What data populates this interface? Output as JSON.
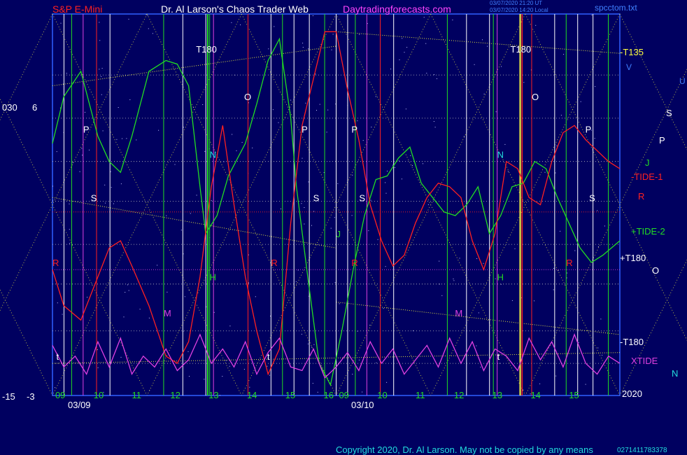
{
  "header": {
    "symbol": "S&P E-Mini",
    "author": "Dr. Al Larson's Chaos Trader Web",
    "site": "Daytradingforecasts.com",
    "timestamp1": "03/07/2020 21:20 UT",
    "timestamp2": "03/07/2020 14:20 Local",
    "file": "spcctom.txt"
  },
  "left_axis": {
    "top_a": "030",
    "top_b": "6",
    "bottom_a": "-15",
    "bottom_b": "-3"
  },
  "dates": [
    "03/09",
    "03/10"
  ],
  "right_labels": {
    "t135": "-T135",
    "v": "V",
    "u": "U",
    "s": "S",
    "p": "P",
    "j": "J",
    "tide1": "-TIDE-1",
    "r": "R",
    "tide2": "+TIDE-2",
    "t180a": "+T180",
    "o": "O",
    "t180b": "-T180",
    "xtide": "XTIDE",
    "n": "N",
    "year": "2020"
  },
  "footer": {
    "copyright": "Copyright 2020, Dr. Al Larson. May not be copied by any means",
    "code": "0271411783378"
  },
  "colors": {
    "background": "#000060",
    "plot_border": "#3060ff",
    "green": "#22dd22",
    "red": "#ff2020",
    "magenta": "#e040e0",
    "yellow_dotted": "#e0e040"
  },
  "chart_data": {
    "type": "line",
    "title": "S&P E-Mini",
    "x_ticks_day1": [
      "09",
      "10",
      "11",
      "12",
      "13",
      "14",
      "15",
      "16"
    ],
    "x_ticks_day2": [
      "09",
      "10",
      "11",
      "12",
      "13",
      "14",
      "15"
    ],
    "markers_top": [
      {
        "label": "T180",
        "x": 12.8,
        "day": 1
      },
      {
        "label": "T180",
        "x": 13.6,
        "day": 2
      }
    ],
    "planet_letters": [
      {
        "l": "P",
        "x": 9.6,
        "y": 0.7,
        "c": "#ffffff"
      },
      {
        "l": "S",
        "x": 9.8,
        "y": 0.51,
        "c": "#ffffff"
      },
      {
        "l": "R",
        "x": 8.8,
        "y": 0.33,
        "c": "#ff2020"
      },
      {
        "l": "M",
        "x": 11.7,
        "y": 0.19,
        "c": "#e040e0"
      },
      {
        "l": "t",
        "x": 8.9,
        "y": 0.07,
        "c": "#ffffff"
      },
      {
        "l": "N",
        "x": 12.9,
        "y": 0.63,
        "c": "#22dddd"
      },
      {
        "l": "H",
        "x": 12.9,
        "y": 0.29,
        "c": "#22dd22"
      },
      {
        "l": "O",
        "x": 13.8,
        "y": 0.79,
        "c": "#ffffff"
      },
      {
        "l": "R",
        "x": 14.5,
        "y": 0.33,
        "c": "#ff2020"
      },
      {
        "l": "t",
        "x": 14.4,
        "y": 0.07,
        "c": "#ffffff"
      },
      {
        "l": "P",
        "x": 15.3,
        "y": 0.7,
        "c": "#ffffff"
      },
      {
        "l": "S",
        "x": 15.6,
        "y": 0.51,
        "c": "#ffffff"
      },
      {
        "l": "R",
        "x": 16.6,
        "y": 0.33,
        "c": "#ff2020"
      },
      {
        "l": "P",
        "x": 9.2,
        "y": 0.7,
        "c": "#ffffff",
        "day": 2
      },
      {
        "l": "S",
        "x": 9.4,
        "y": 0.51,
        "c": "#ffffff",
        "day": 2
      },
      {
        "l": "J",
        "x": 8.8,
        "y": 0.41,
        "c": "#22dd22",
        "day": 2
      },
      {
        "l": "M",
        "x": 11.9,
        "y": 0.19,
        "c": "#e040e0",
        "day": 2
      },
      {
        "l": "N",
        "x": 13.0,
        "y": 0.63,
        "c": "#22dddd",
        "day": 2
      },
      {
        "l": "H",
        "x": 13.0,
        "y": 0.29,
        "c": "#22dd22",
        "day": 2
      },
      {
        "l": "O",
        "x": 13.9,
        "y": 0.79,
        "c": "#ffffff",
        "day": 2
      },
      {
        "l": "t",
        "x": 13.0,
        "y": 0.07,
        "c": "#ffffff",
        "day": 2
      },
      {
        "l": "R",
        "x": 14.8,
        "y": 0.33,
        "c": "#ff2020",
        "day": 2
      },
      {
        "l": "P",
        "x": 15.3,
        "y": 0.7,
        "c": "#ffffff",
        "day": 2
      },
      {
        "l": "S",
        "x": 15.4,
        "y": 0.51,
        "c": "#ffffff",
        "day": 2
      }
    ],
    "series": [
      {
        "name": "TIDE-2",
        "color": "#22dd22",
        "x": [
          0,
          0.02,
          0.05,
          0.08,
          0.1,
          0.12,
          0.14,
          0.17,
          0.2,
          0.22,
          0.24,
          0.26,
          0.27,
          0.29,
          0.31,
          0.34,
          0.36,
          0.38,
          0.4,
          0.42,
          0.43,
          0.45,
          0.47,
          0.49,
          0.51,
          0.53,
          0.55,
          0.57,
          0.59,
          0.61,
          0.63,
          0.65,
          0.67,
          0.69,
          0.71,
          0.73,
          0.75,
          0.77,
          0.79,
          0.81,
          0.83,
          0.85,
          0.87,
          0.89,
          0.91,
          0.93,
          0.95,
          0.97,
          1.0
        ],
        "y": [
          0.67,
          0.8,
          0.87,
          0.69,
          0.62,
          0.59,
          0.69,
          0.87,
          0.9,
          0.89,
          0.83,
          0.55,
          0.42,
          0.47,
          0.58,
          0.67,
          0.78,
          0.9,
          0.96,
          0.74,
          0.55,
          0.3,
          0.06,
          0.0,
          0.15,
          0.32,
          0.47,
          0.57,
          0.58,
          0.63,
          0.66,
          0.56,
          0.52,
          0.48,
          0.47,
          0.5,
          0.55,
          0.42,
          0.47,
          0.55,
          0.56,
          0.62,
          0.6,
          0.52,
          0.45,
          0.38,
          0.34,
          0.36,
          0.4
        ]
      },
      {
        "name": "TIDE-1",
        "color": "#ff2020",
        "x": [
          0,
          0.02,
          0.05,
          0.08,
          0.1,
          0.12,
          0.14,
          0.17,
          0.2,
          0.22,
          0.24,
          0.26,
          0.28,
          0.3,
          0.32,
          0.34,
          0.36,
          0.38,
          0.4,
          0.42,
          0.44,
          0.46,
          0.48,
          0.5,
          0.52,
          0.54,
          0.56,
          0.58,
          0.6,
          0.62,
          0.64,
          0.66,
          0.68,
          0.7,
          0.72,
          0.74,
          0.76,
          0.78,
          0.8,
          0.82,
          0.84,
          0.86,
          0.88,
          0.9,
          0.92,
          0.94,
          0.96,
          0.98,
          1.0
        ],
        "y": [
          0.32,
          0.22,
          0.18,
          0.3,
          0.38,
          0.4,
          0.33,
          0.22,
          0.08,
          0.06,
          0.12,
          0.3,
          0.55,
          0.72,
          0.5,
          0.3,
          0.15,
          0.03,
          0.1,
          0.45,
          0.72,
          0.85,
          0.98,
          0.98,
          0.82,
          0.68,
          0.5,
          0.4,
          0.33,
          0.36,
          0.45,
          0.52,
          0.56,
          0.55,
          0.52,
          0.4,
          0.32,
          0.42,
          0.62,
          0.6,
          0.52,
          0.5,
          0.62,
          0.7,
          0.72,
          0.68,
          0.65,
          0.62,
          0.6
        ]
      },
      {
        "name": "XTIDE",
        "color": "#e040e0",
        "x": [
          0,
          0.02,
          0.04,
          0.06,
          0.08,
          0.1,
          0.12,
          0.14,
          0.16,
          0.18,
          0.2,
          0.22,
          0.24,
          0.26,
          0.28,
          0.3,
          0.32,
          0.34,
          0.36,
          0.38,
          0.4,
          0.42,
          0.44,
          0.46,
          0.48,
          0.5,
          0.52,
          0.54,
          0.56,
          0.58,
          0.6,
          0.62,
          0.64,
          0.66,
          0.68,
          0.7,
          0.72,
          0.74,
          0.76,
          0.78,
          0.8,
          0.82,
          0.84,
          0.86,
          0.88,
          0.9,
          0.92,
          0.94,
          0.96,
          0.98,
          1.0
        ],
        "y": [
          0.11,
          0.05,
          0.08,
          0.03,
          0.12,
          0.05,
          0.13,
          0.03,
          0.08,
          0.05,
          0.1,
          0.04,
          0.07,
          0.14,
          0.06,
          0.1,
          0.05,
          0.12,
          0.03,
          0.09,
          0.13,
          0.05,
          0.04,
          0.1,
          0.02,
          0.05,
          0.09,
          0.04,
          0.12,
          0.06,
          0.1,
          0.03,
          0.07,
          0.11,
          0.05,
          0.13,
          0.06,
          0.12,
          0.04,
          0.1,
          0.08,
          0.04,
          0.13,
          0.07,
          0.12,
          0.05,
          0.14,
          0.06,
          0.03,
          0.08,
          0.06
        ]
      }
    ]
  }
}
